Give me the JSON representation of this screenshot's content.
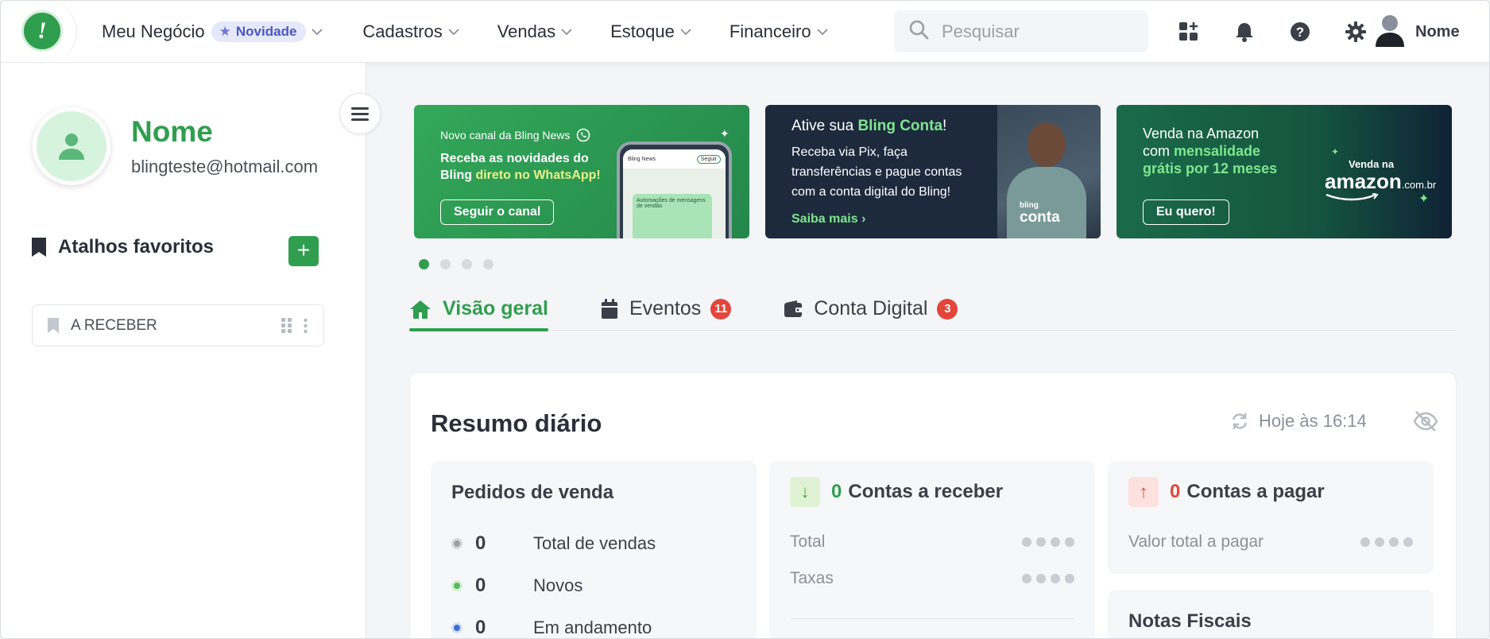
{
  "nav": {
    "logo_glyph": "!",
    "items": [
      {
        "label": "Meu Negócio",
        "badge": "Novidade"
      },
      {
        "label": "Cadastros"
      },
      {
        "label": "Vendas"
      },
      {
        "label": "Estoque"
      },
      {
        "label": "Financeiro"
      }
    ],
    "search_placeholder": "Pesquisar",
    "icons": [
      "apps-icon",
      "bell-icon",
      "help-icon",
      "gear-icon"
    ],
    "user_name": "Nome"
  },
  "sidebar": {
    "name": "Nome",
    "email": "blingteste@hotmail.com",
    "favorites_title": "Atalhos favoritos",
    "favorites": [
      {
        "label": "A RECEBER"
      }
    ]
  },
  "banners": [
    {
      "kicker": "Novo canal da Bling News",
      "line1": "Receba as novidades do",
      "line2_a": "Bling ",
      "line2_b": "direto no WhatsApp!",
      "button": "Seguir o canal",
      "phone_header": "Bling News",
      "phone_follow": "Seguir",
      "phone_chip": "Automações de mensagens de vendas"
    },
    {
      "title_a": "Ative sua ",
      "title_b": "Bling Conta",
      "title_c": "!",
      "body1": "Receba via Pix, faça",
      "body2": "transferências e pague contas",
      "body3": "com a conta digital do Bling!",
      "link": "Saiba mais",
      "logo_small": "bling",
      "logo_big": "conta"
    },
    {
      "line1": "Venda na Amazon",
      "line2_a": "com ",
      "line2_b": "mensalidade",
      "line3": "grátis por 12 meses",
      "button": "Eu quero!",
      "logo_top": "Venda na",
      "logo_main": "amazon",
      "logo_suffix": ".com.br"
    }
  ],
  "carousel": {
    "total": 4,
    "active": 0
  },
  "tabs": [
    {
      "label": "Visão geral",
      "active": true
    },
    {
      "label": "Eventos",
      "count": "11"
    },
    {
      "label": "Conta Digital",
      "count": "3"
    }
  ],
  "summary": {
    "title": "Resumo diário",
    "updated": "Hoje às 16:14",
    "orders": {
      "title": "Pedidos de venda",
      "rows": [
        {
          "value": "0",
          "label": "Total de vendas",
          "color": "#9aa0a9"
        },
        {
          "value": "0",
          "label": "Novos",
          "color": "#5cb85c"
        },
        {
          "value": "0",
          "label": "Em andamento",
          "color": "#3b6fd4"
        }
      ]
    },
    "receivable": {
      "count": "0",
      "title": "Contas a receber",
      "rows": [
        "Total",
        "Taxas"
      ]
    },
    "payable": {
      "count": "0",
      "title": "Contas a pagar",
      "rows": [
        "Valor total a pagar"
      ]
    },
    "invoices": {
      "title": "Notas Fiscais"
    }
  },
  "colors": {
    "brand": "#2f9e4f",
    "danger": "#e4453a",
    "accent": "#4a56c4"
  }
}
